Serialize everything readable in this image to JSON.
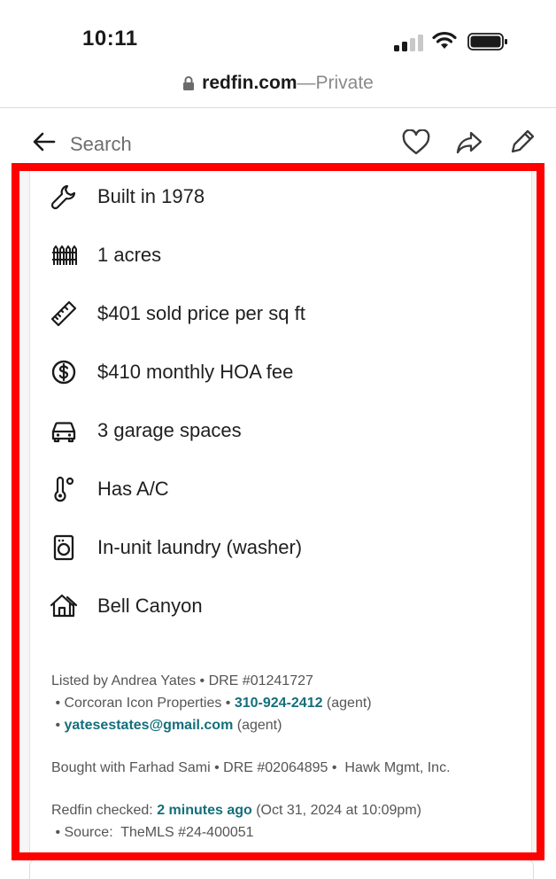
{
  "status_bar": {
    "time": "10:11"
  },
  "browser": {
    "domain": "redfin.com",
    "separator": " — ",
    "private_label": "Private"
  },
  "toolbar": {
    "search_label": "Search"
  },
  "facts": [
    {
      "icon": "wrench-icon",
      "label": "Built in 1978"
    },
    {
      "icon": "fence-icon",
      "label": "1 acres"
    },
    {
      "icon": "ruler-icon",
      "label": "$401 sold price per sq ft"
    },
    {
      "icon": "dollar-circle-icon",
      "label": "$410 monthly HOA fee"
    },
    {
      "icon": "car-icon",
      "label": "3 garage spaces"
    },
    {
      "icon": "thermometer-icon",
      "label": "Has A/C"
    },
    {
      "icon": "washer-icon",
      "label": "In-unit laundry (washer)"
    },
    {
      "icon": "house-icon",
      "label": "Bell Canyon"
    }
  ],
  "listing": {
    "listed_by": "Listed by Andrea Yates • DRE #01241727",
    "brokerage_prefix": " • Corcoran Icon Properties • ",
    "phone": "310-924-2412",
    "phone_suffix": " (agent)",
    "email_prefix": " • ",
    "email": "yatesestates@gmail.com",
    "email_suffix": " (agent)",
    "bought_with": "Bought with Farhad Sami • DRE #02064895 •  Hawk Mgmt, Inc.",
    "checked_prefix": "Redfin checked: ",
    "checked_time": "2 minutes ago",
    "checked_date": " (Oct 31, 2024 at 10:09pm)",
    "source": " • Source:  TheMLS #24-400051"
  },
  "colors": {
    "highlight": "#ff0000",
    "link": "#136f7a"
  }
}
